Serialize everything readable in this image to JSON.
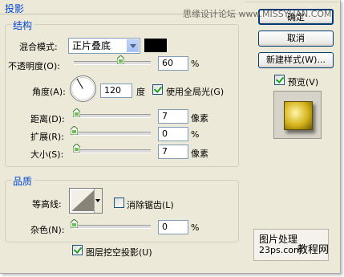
{
  "window": {
    "title": "投影"
  },
  "structure": {
    "title": "结构",
    "blend_mode_label": "混合模式:",
    "blend_mode_value": "正片叠底",
    "shadow_color": "#000000",
    "opacity_label": "不透明度(O):",
    "opacity_value": "60",
    "opacity_unit": "%",
    "opacity_level": 60,
    "angle_label": "角度(A):",
    "angle_value": "120",
    "angle_unit": "度",
    "global_light_label": "使用全局光(G)",
    "global_light_checked": true,
    "distance_label": "距离(D):",
    "distance_value": "7",
    "distance_unit": "像素",
    "spread_label": "扩展(R):",
    "spread_value": "0",
    "spread_unit": "%",
    "size_label": "大小(S):",
    "size_value": "7",
    "size_unit": "像素"
  },
  "quality": {
    "title": "品质",
    "contour_label": "等高线:",
    "anti_alias_label": "消除锯齿(L)",
    "anti_alias_checked": false,
    "noise_label": "杂色(N):",
    "noise_value": "0",
    "noise_unit": "%",
    "knockout_label": "图层挖空投影(U)",
    "knockout_checked": true
  },
  "buttons": {
    "ok": "确定",
    "cancel": "取消",
    "new_style": "新建样式(W)...",
    "preview_label": "预览(V)",
    "preview_checked": true
  },
  "watermarks": {
    "top": "思缘设计论坛 www.MISSYUAN.COM",
    "bottom_line1": "图片处理",
    "bottom_line1b": "教程网",
    "bottom_line2": "23ps.com"
  }
}
